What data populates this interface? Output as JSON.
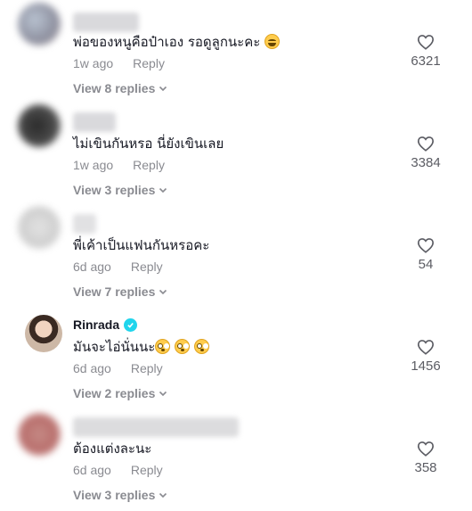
{
  "comments": [
    {
      "username": "",
      "text": "พ่อของหนูคือป๋าเอง รอดูลูกนะคะ",
      "emoji": "laughing-emoji",
      "time": "1w ago",
      "reply_label": "Reply",
      "view_replies": "View 8 replies",
      "likes": "6321"
    },
    {
      "username": "",
      "text": "ไม่เขินกันหรอ นี่ยังเขินเลย",
      "time": "1w ago",
      "reply_label": "Reply",
      "view_replies": "View 3 replies",
      "likes": "3384"
    },
    {
      "username": "",
      "text": "พี่เค้าเป็นแฟนกันหรอคะ",
      "time": "6d ago",
      "reply_label": "Reply",
      "view_replies": "View 7 replies",
      "likes": "54"
    },
    {
      "username": "Rinrada",
      "verified": true,
      "text": "มันจะไอ่นั่นนะ",
      "emoji": "flushed-emoji",
      "time": "6d ago",
      "reply_label": "Reply",
      "view_replies": "View 2 replies",
      "likes": "1456"
    },
    {
      "username": "",
      "text": "ต้องแต่งละนะ",
      "time": "6d ago",
      "reply_label": "Reply",
      "view_replies": "View 3 replies",
      "likes": "358"
    }
  ],
  "colors": {
    "text": "#161823",
    "muted": "#8a8b91",
    "verified": "#20D5EC"
  }
}
